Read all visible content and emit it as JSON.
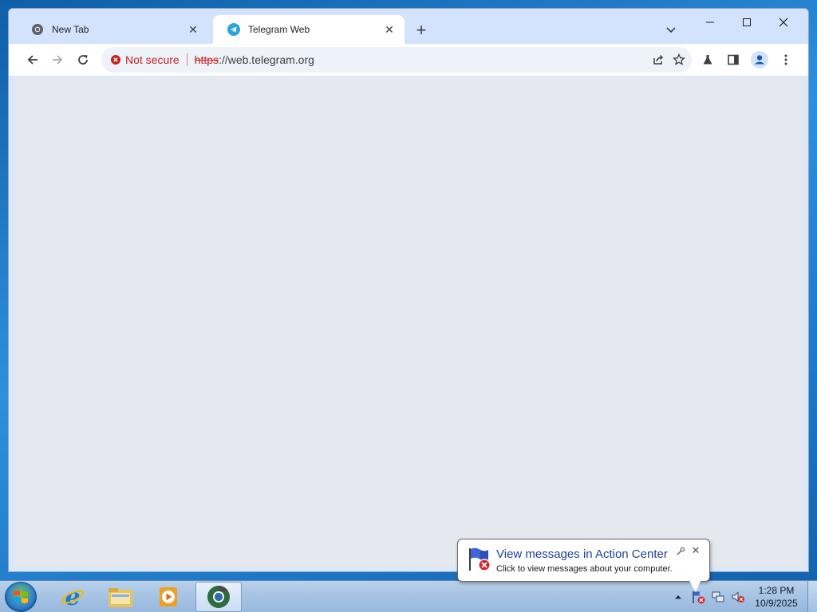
{
  "browser": {
    "tabs": [
      {
        "title": "New Tab",
        "icon": "chrome-icon",
        "active": false
      },
      {
        "title": "Telegram Web",
        "icon": "telegram-icon",
        "active": true
      }
    ],
    "new_tab_symbol": "+",
    "address_bar": {
      "security_label": "Not secure",
      "url_scheme": "https",
      "url_rest": "://web.telegram.org"
    }
  },
  "page": {
    "content_background": "#e5e9ef"
  },
  "notification": {
    "title": "View messages in Action Center",
    "message": "Click to view messages about your computer."
  },
  "taskbar": {
    "pinned_apps": [
      "internet-explorer-icon",
      "windows-explorer-icon",
      "media-player-icon",
      "chrome-icon"
    ],
    "clock": {
      "time": "1:28 PM",
      "date": "10/9/2025"
    }
  },
  "colors": {
    "not_secure": "#c5221f",
    "tabstrip": "#d3e3fd",
    "taskbar": "#a6c3e3"
  }
}
